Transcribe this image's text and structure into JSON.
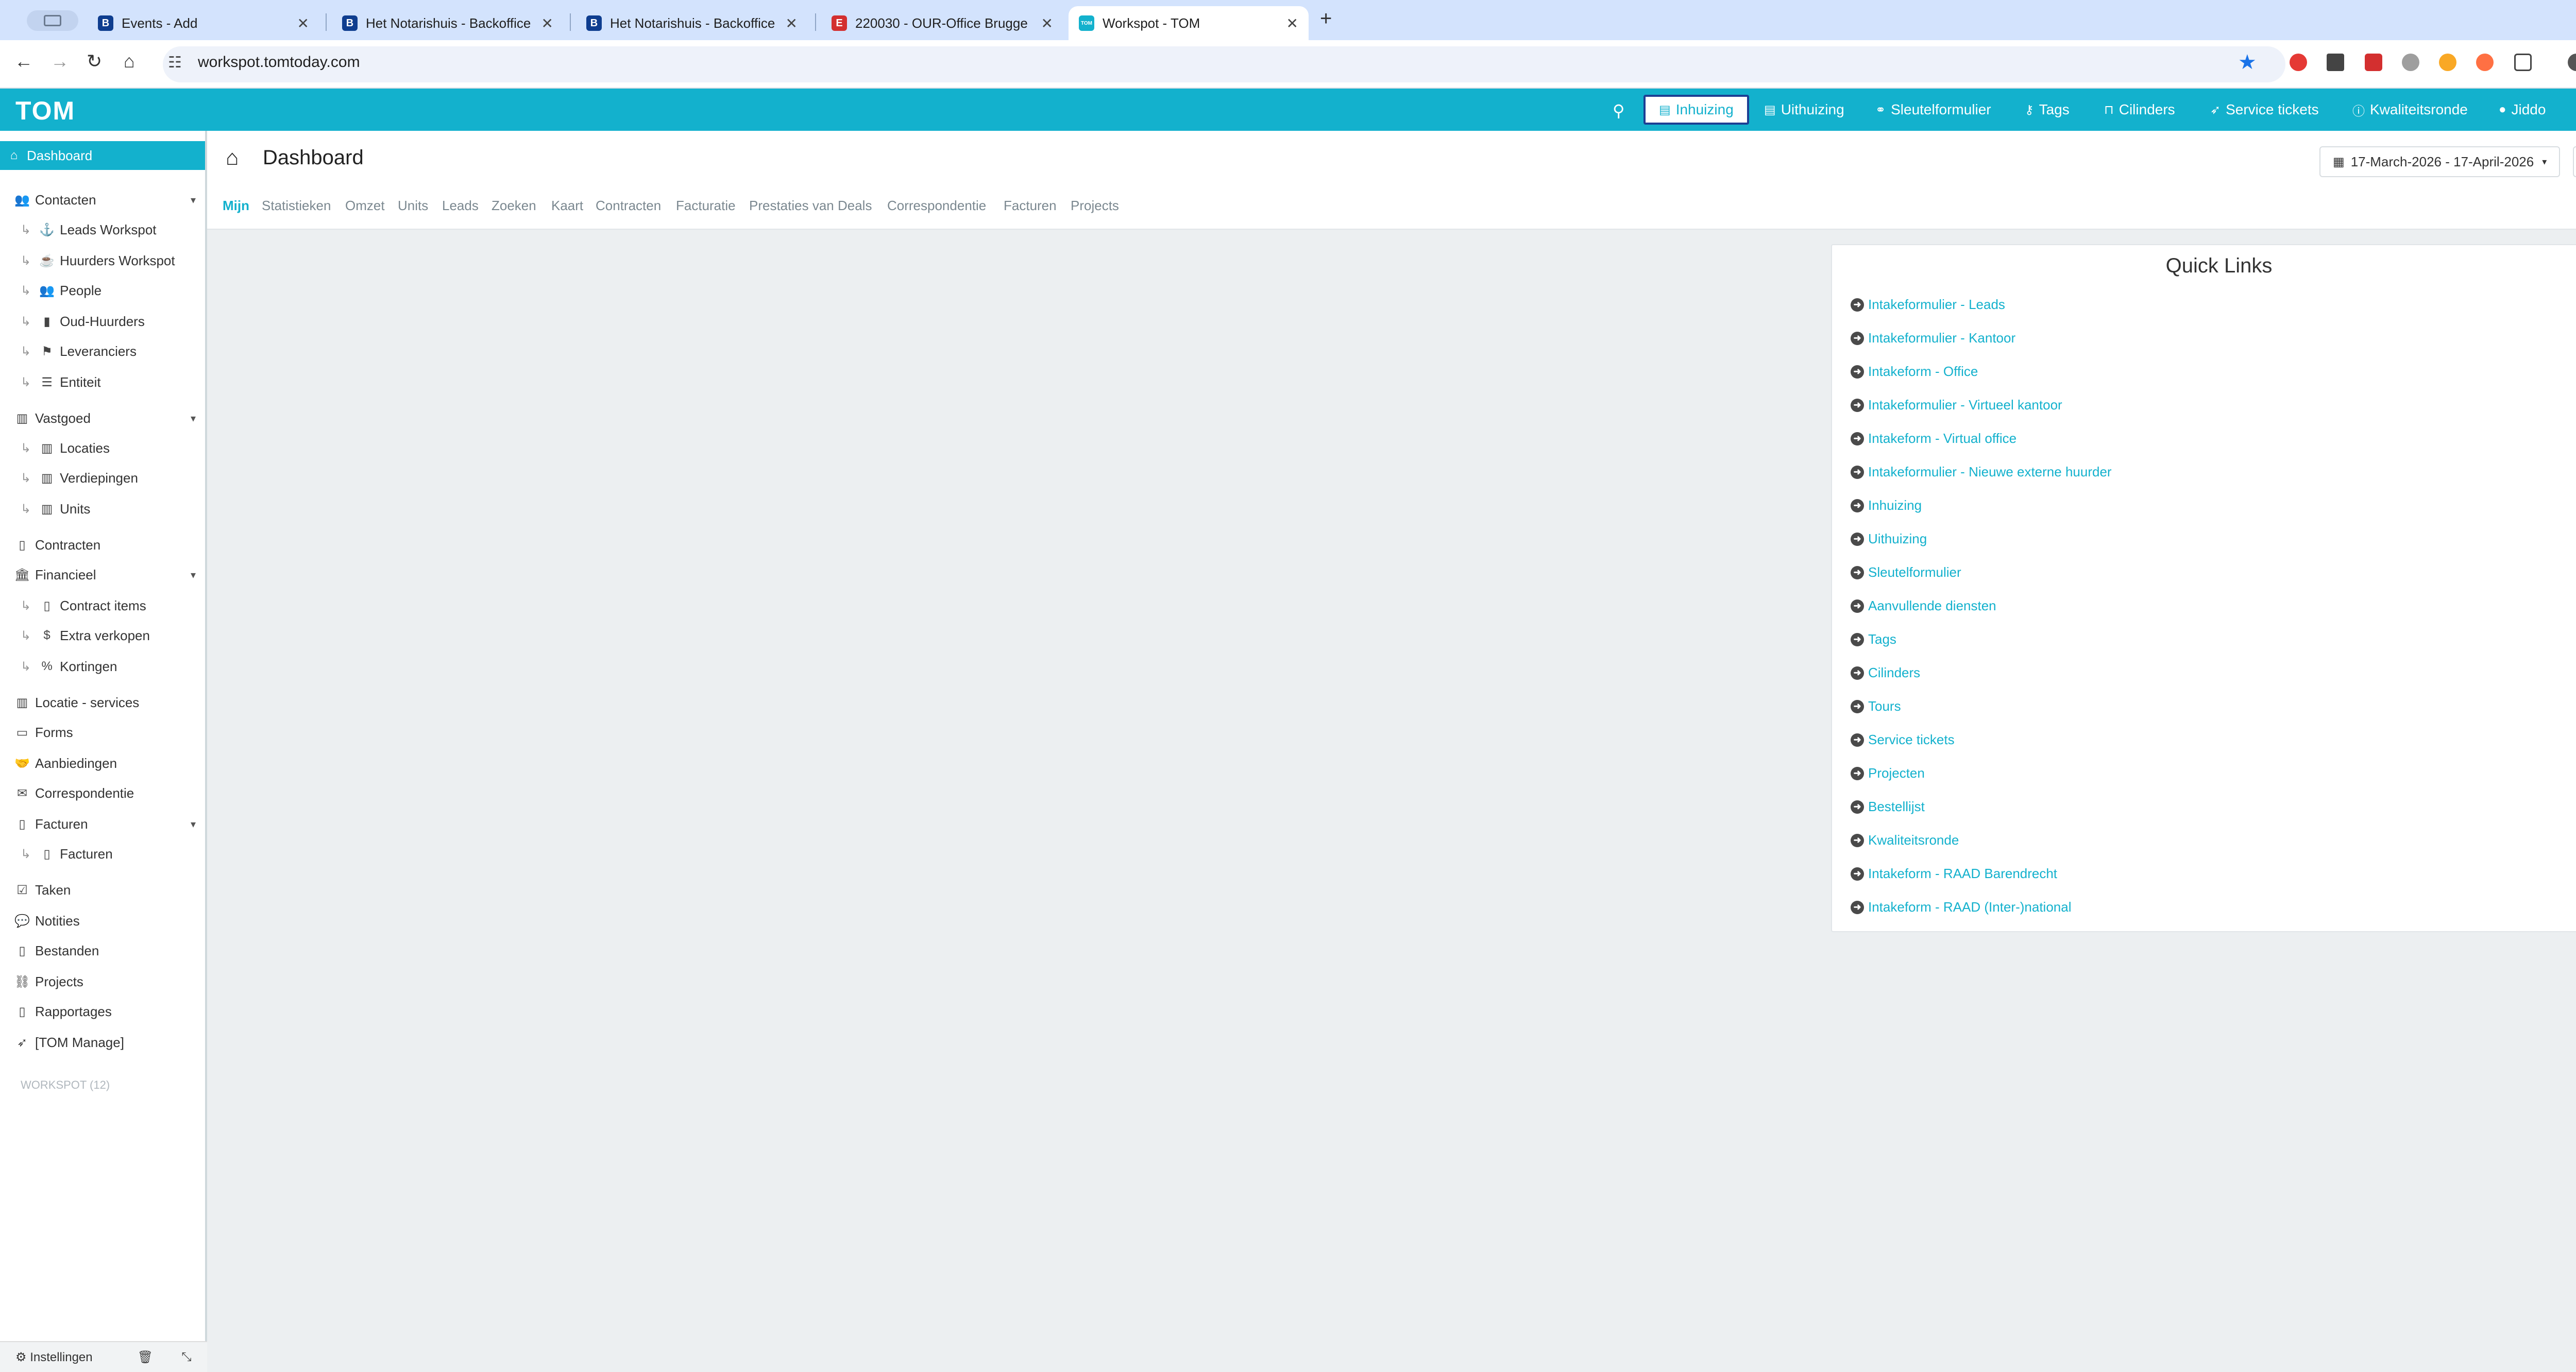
{
  "browser": {
    "tabs": [
      {
        "title": "Events - Add",
        "favicon": "B",
        "favicon_color": "#0e3d8f"
      },
      {
        "title": "Het Notarishuis - Backoffice",
        "favicon": "B",
        "favicon_color": "#0e3d8f"
      },
      {
        "title": "Het Notarishuis - Backoffice",
        "favicon": "B",
        "favicon_color": "#0e3d8f"
      },
      {
        "title": "220030 - OUR-Office Brugge",
        "favicon": "E",
        "favicon_color": "#d32f2f"
      },
      {
        "title": "Workspot - TOM",
        "favicon": "TOM",
        "favicon_color": "#13b1cd"
      }
    ],
    "new_tab": "+",
    "url": "workspot.tomtoday.com"
  },
  "app": {
    "logo": "TOM",
    "accent_color": "#13b1cd",
    "nav": [
      {
        "label": "Inhuizing",
        "icon": "id-card-icon",
        "glyph": "▤"
      },
      {
        "label": "Uithuizing",
        "icon": "id-card-icon",
        "glyph": "▤"
      },
      {
        "label": "Sleutelformulier",
        "icon": "link-icon",
        "glyph": "⚭"
      },
      {
        "label": "Tags",
        "icon": "key-icon",
        "glyph": "⚷"
      },
      {
        "label": "Cilinders",
        "icon": "unlock-icon",
        "glyph": "⊓"
      },
      {
        "label": "Service tickets",
        "icon": "rocket-icon",
        "glyph": "➶"
      },
      {
        "label": "Kwaliteitsronde",
        "icon": "info-icon",
        "glyph": "ⓘ"
      },
      {
        "label": "Jiddo",
        "icon": "user-icon",
        "glyph": "●"
      }
    ]
  },
  "sidebar": {
    "items": [
      {
        "label": "Dashboard",
        "glyph": "⌂"
      },
      {
        "label": "Contacten",
        "glyph": "👥",
        "caret": "▾"
      },
      {
        "label": "Leads Workspot",
        "glyph": "⚓"
      },
      {
        "label": "Huurders Workspot",
        "glyph": "☕"
      },
      {
        "label": "People",
        "glyph": "👥"
      },
      {
        "label": "Oud-Huurders",
        "glyph": "▮"
      },
      {
        "label": "Leveranciers",
        "glyph": "⚑"
      },
      {
        "label": "Entiteit",
        "glyph": "☰"
      },
      {
        "label": "Vastgoed",
        "glyph": "▥",
        "caret": "▾"
      },
      {
        "label": "Locaties",
        "glyph": "▥"
      },
      {
        "label": "Verdiepingen",
        "glyph": "▥"
      },
      {
        "label": "Units",
        "glyph": "▥"
      },
      {
        "label": "Contracten",
        "glyph": "▯"
      },
      {
        "label": "Financieel",
        "glyph": "🏛",
        "caret": "▾"
      },
      {
        "label": "Contract items",
        "glyph": "▯"
      },
      {
        "label": "Extra verkopen",
        "glyph": "$"
      },
      {
        "label": "Kortingen",
        "glyph": "%"
      },
      {
        "label": "Locatie - services",
        "glyph": "▥"
      },
      {
        "label": "Forms",
        "glyph": "▭"
      },
      {
        "label": "Aanbiedingen",
        "glyph": "🤝"
      },
      {
        "label": "Correspondentie",
        "glyph": "✉"
      },
      {
        "label": "Facturen",
        "glyph": "▯",
        "caret": "▾"
      },
      {
        "label": "Facturen",
        "glyph": "▯"
      },
      {
        "label": "Taken",
        "glyph": "☑"
      },
      {
        "label": "Notities",
        "glyph": "💬"
      },
      {
        "label": "Bestanden",
        "glyph": "▯"
      },
      {
        "label": "Projects",
        "glyph": "⛓"
      },
      {
        "label": "Rapportages",
        "glyph": "▯"
      },
      {
        "label": "[TOM Manage]",
        "glyph": "➶"
      }
    ],
    "workspot_label": "WORKSPOT (12)",
    "footer": {
      "settings": "Instellingen"
    }
  },
  "main": {
    "title": "Dashboard",
    "date_range": "17-March-2026 - 17-April-2026",
    "tabs": [
      "Mijn",
      "Statistieken",
      "Omzet",
      "Units",
      "Leads",
      "Zoeken",
      "Kaart",
      "Contracten",
      "Facturatie",
      "Prestaties van Deals",
      "Correspondentie",
      "Facturen",
      "Projects"
    ],
    "active_tab": "Mijn",
    "quick_links": {
      "title": "Quick Links",
      "links": [
        "Intakeformulier - Leads",
        "Intakeformulier - Kantoor",
        "Intakeform - Office",
        "Intakeformulier - Virtueel kantoor",
        "Intakeform - Virtual office",
        "Intakeformulier - Nieuwe externe huurder",
        "Inhuizing",
        "Uithuizing",
        "Sleutelformulier",
        "Aanvullende diensten",
        "Tags",
        "Cilinders",
        "Tours",
        "Service tickets",
        "Projecten",
        "Bestellijst",
        "Kwaliteitsronde",
        "Intakeform - RAAD Barendrecht",
        "Intakeform - RAAD (Inter-)national"
      ]
    }
  }
}
